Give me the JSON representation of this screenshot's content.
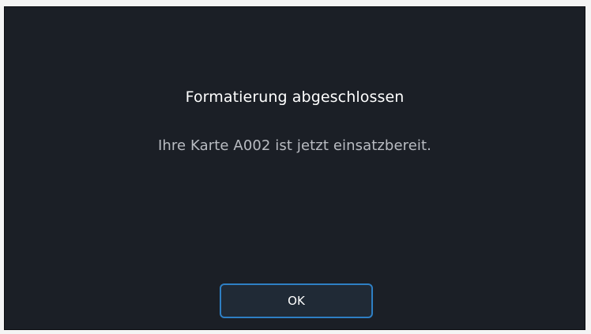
{
  "dialog": {
    "title": "Formatierung abgeschlossen",
    "message": "Ihre Karte A002 ist jetzt einsatzbereit.",
    "ok_label": "OK"
  },
  "colors": {
    "background": "#1b1f26",
    "title_text": "#ffffff",
    "message_text": "#b9bcc2",
    "button_border": "#2e7fc4",
    "button_fill": "#202a36"
  }
}
